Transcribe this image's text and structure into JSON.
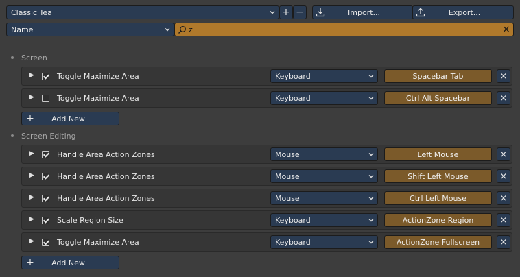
{
  "header": {
    "preset": "Classic Tea",
    "add_symbol": "+",
    "remove_symbol": "−",
    "import_label": "Import...",
    "export_label": "Export..."
  },
  "filter": {
    "mode": "Name",
    "search_value": "z",
    "clear_symbol": "×"
  },
  "sections": [
    {
      "title": "Screen",
      "items": [
        {
          "name": "Toggle Maximize Area",
          "enabled": true,
          "device": "Keyboard",
          "binding": "Spacebar Tab"
        },
        {
          "name": "Toggle Maximize Area",
          "enabled": false,
          "device": "Keyboard",
          "binding": "Ctrl Alt Spacebar"
        }
      ],
      "add_label": "Add New"
    },
    {
      "title": "Screen Editing",
      "items": [
        {
          "name": "Handle Area Action Zones",
          "enabled": true,
          "device": "Mouse",
          "binding": "Left Mouse"
        },
        {
          "name": "Handle Area Action Zones",
          "enabled": true,
          "device": "Mouse",
          "binding": "Shift Left Mouse"
        },
        {
          "name": "Handle Area Action Zones",
          "enabled": true,
          "device": "Mouse",
          "binding": "Ctrl Left Mouse"
        },
        {
          "name": "Scale Region Size",
          "enabled": true,
          "device": "Keyboard",
          "binding": "ActionZone Region"
        },
        {
          "name": "Toggle Maximize Area",
          "enabled": true,
          "device": "Keyboard",
          "binding": "ActionZone Fullscreen"
        }
      ],
      "add_label": "Add New"
    }
  ],
  "symbols": {
    "expand": "▶",
    "chevron": "⌄",
    "remove": "×",
    "plus": "+"
  }
}
